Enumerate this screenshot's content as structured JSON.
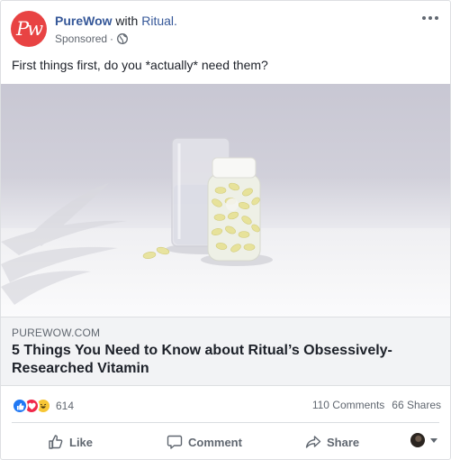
{
  "post": {
    "page_name": "PureWow",
    "with_text": "with",
    "partner": "Ritual.",
    "sponsored": "Sponsored",
    "dot": "·",
    "text": "First things first, do you *actually* need them?",
    "avatar_logo": "Pw"
  },
  "link": {
    "domain": "PUREWOW.COM",
    "headline": "5 Things You Need to Know about Ritual’s Obsessively-Researched Vitamin"
  },
  "stats": {
    "reactions_count": "614",
    "comments": "110 Comments",
    "shares": "66 Shares"
  },
  "actions": {
    "like": "Like",
    "comment": "Comment",
    "share": "Share"
  },
  "icons": {
    "globe": "globe-icon",
    "more": "more-options-icon",
    "like": "thumbs-up-icon",
    "comment": "comment-bubble-icon",
    "share": "share-arrow-icon",
    "caret": "caret-down-icon"
  },
  "colors": {
    "link_blue": "#365899",
    "brand_red": "#e84343",
    "like_blue": "#2078f4",
    "love_red": "#f0284a",
    "haha_yellow": "#f7c635",
    "muted_text": "#606770"
  }
}
